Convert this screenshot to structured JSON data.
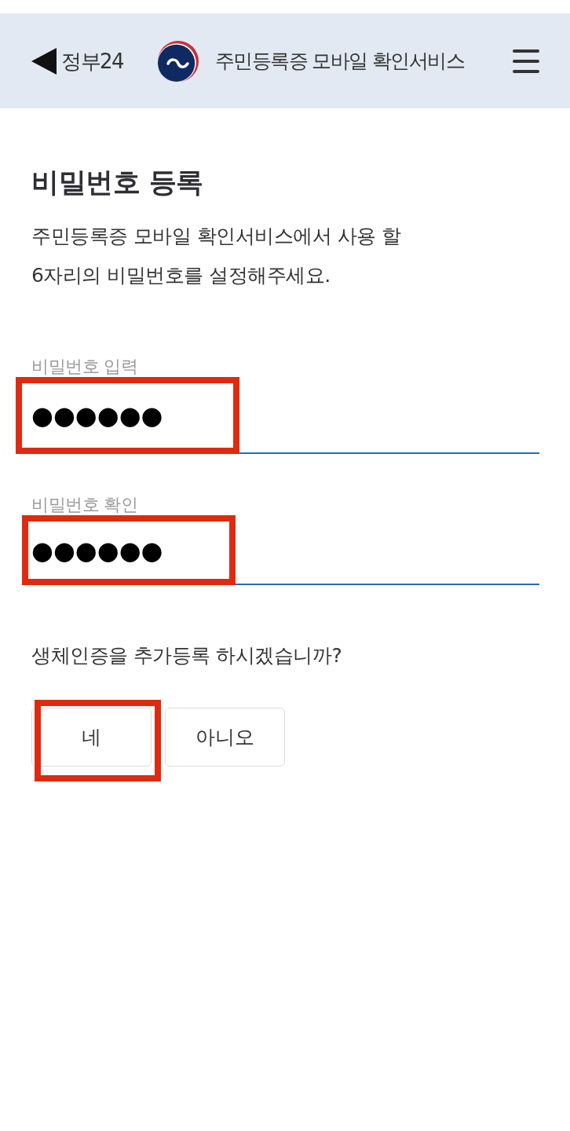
{
  "header": {
    "back_label": "정부24",
    "title": "주민등록증 모바일 확인서비스"
  },
  "heading": "비밀번호 등록",
  "description": "주민등록증 모바일 확인서비스에서 사용 할\n6자리의 비밀번호를 설정해주세요.",
  "fields": [
    {
      "label": "비밀번호 입력",
      "value": "●●●●●●",
      "highlighted": true
    },
    {
      "label": "비밀번호 확인",
      "value": "●●●●●●",
      "highlighted": true
    }
  ],
  "question": "생체인증을 추가등록 하시겠습니까?",
  "choices": [
    {
      "label": "네",
      "highlighted": true
    },
    {
      "label": "아니오",
      "highlighted": false
    }
  ]
}
